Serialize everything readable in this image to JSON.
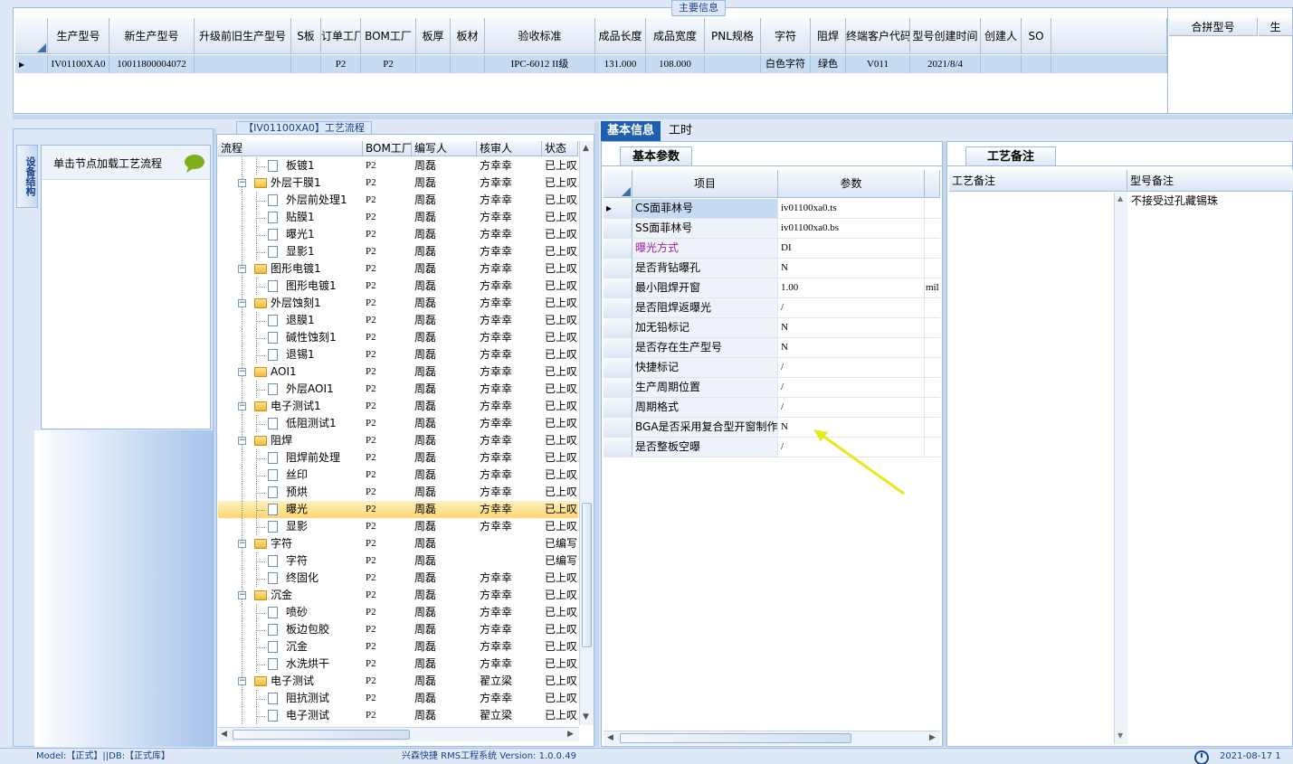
{
  "main_info": {
    "title": "主要信息",
    "columns": [
      "生产型号",
      "新生产型号",
      "升级前旧生产型号",
      "S板",
      "订单工厂",
      "BOM工厂",
      "板厚",
      "板材",
      "验收标准",
      "成品长度",
      "成品宽度",
      "PNL规格",
      "字符",
      "阻焊",
      "终端客户代码",
      "型号创建时间",
      "创建人",
      "SO"
    ],
    "row": [
      "IV01100XA0",
      "10011800004072",
      "",
      "",
      "P2",
      "P2",
      "",
      "",
      "IPC-6012 II级",
      "131.000",
      "108.000",
      "",
      "白色字符",
      "绿色",
      "V011",
      "2021/8/4",
      "",
      ""
    ],
    "side_columns": [
      "合拼型号",
      "生"
    ]
  },
  "left_panel": {
    "tab_label": "设备结构",
    "hint": "单击节点加载工艺流程"
  },
  "flow": {
    "title": "【IV01100XA0】工艺流程",
    "columns": [
      "流程",
      "BOM工厂",
      "编写人",
      "核审人",
      "状态"
    ],
    "rows": [
      {
        "level": 2,
        "type": "doc",
        "name": "板镀1",
        "bom": "P2",
        "writer": "周磊",
        "reviewer": "方幸幸",
        "status": "已上叹"
      },
      {
        "level": 1,
        "type": "folder",
        "name": "外层干膜1",
        "bom": "P2",
        "writer": "周磊",
        "reviewer": "方幸幸",
        "status": "已上叹"
      },
      {
        "level": 2,
        "type": "doc",
        "name": "外层前处理1",
        "bom": "P2",
        "writer": "周磊",
        "reviewer": "方幸幸",
        "status": "已上叹"
      },
      {
        "level": 2,
        "type": "doc",
        "name": "贴膜1",
        "bom": "P2",
        "writer": "周磊",
        "reviewer": "方幸幸",
        "status": "已上叹"
      },
      {
        "level": 2,
        "type": "doc",
        "name": "曝光1",
        "bom": "P2",
        "writer": "周磊",
        "reviewer": "方幸幸",
        "status": "已上叹"
      },
      {
        "level": 2,
        "type": "doc",
        "name": "显影1",
        "bom": "P2",
        "writer": "周磊",
        "reviewer": "方幸幸",
        "status": "已上叹"
      },
      {
        "level": 1,
        "type": "folder",
        "name": "图形电镀1",
        "bom": "P2",
        "writer": "周磊",
        "reviewer": "方幸幸",
        "status": "已上叹"
      },
      {
        "level": 2,
        "type": "doc",
        "name": "图形电镀1",
        "bom": "P2",
        "writer": "周磊",
        "reviewer": "方幸幸",
        "status": "已上叹"
      },
      {
        "level": 1,
        "type": "folder",
        "name": "外层蚀刻1",
        "bom": "P2",
        "writer": "周磊",
        "reviewer": "方幸幸",
        "status": "已上叹"
      },
      {
        "level": 2,
        "type": "doc",
        "name": "退膜1",
        "bom": "P2",
        "writer": "周磊",
        "reviewer": "方幸幸",
        "status": "已上叹"
      },
      {
        "level": 2,
        "type": "doc",
        "name": "碱性蚀刻1",
        "bom": "P2",
        "writer": "周磊",
        "reviewer": "方幸幸",
        "status": "已上叹"
      },
      {
        "level": 2,
        "type": "doc",
        "name": "退锡1",
        "bom": "P2",
        "writer": "周磊",
        "reviewer": "方幸幸",
        "status": "已上叹"
      },
      {
        "level": 1,
        "type": "folder",
        "name": "AOI1",
        "bom": "P2",
        "writer": "周磊",
        "reviewer": "方幸幸",
        "status": "已上叹"
      },
      {
        "level": 2,
        "type": "doc",
        "name": "外层AOI1",
        "bom": "P2",
        "writer": "周磊",
        "reviewer": "方幸幸",
        "status": "已上叹"
      },
      {
        "level": 1,
        "type": "folder",
        "name": "电子测试1",
        "bom": "P2",
        "writer": "周磊",
        "reviewer": "方幸幸",
        "status": "已上叹"
      },
      {
        "level": 2,
        "type": "doc",
        "name": "低阻测试1",
        "bom": "P2",
        "writer": "周磊",
        "reviewer": "方幸幸",
        "status": "已上叹"
      },
      {
        "level": 1,
        "type": "folder",
        "name": "阻焊",
        "bom": "P2",
        "writer": "周磊",
        "reviewer": "方幸幸",
        "status": "已上叹"
      },
      {
        "level": 2,
        "type": "doc",
        "name": "阻焊前处理",
        "bom": "P2",
        "writer": "周磊",
        "reviewer": "方幸幸",
        "status": "已上叹"
      },
      {
        "level": 2,
        "type": "doc",
        "name": "丝印",
        "bom": "P2",
        "writer": "周磊",
        "reviewer": "方幸幸",
        "status": "已上叹"
      },
      {
        "level": 2,
        "type": "doc",
        "name": "预烘",
        "bom": "P2",
        "writer": "周磊",
        "reviewer": "方幸幸",
        "status": "已上叹"
      },
      {
        "level": 2,
        "type": "doc",
        "name": "曝光",
        "bom": "P2",
        "writer": "周磊",
        "reviewer": "方幸幸",
        "status": "已上叹",
        "selected": true
      },
      {
        "level": 2,
        "type": "doc",
        "name": "显影",
        "bom": "P2",
        "writer": "周磊",
        "reviewer": "方幸幸",
        "status": "已上叹"
      },
      {
        "level": 1,
        "type": "folder",
        "name": "字符",
        "bom": "P2",
        "writer": "周磊",
        "reviewer": "",
        "status": "已编写"
      },
      {
        "level": 2,
        "type": "doc",
        "name": "字符",
        "bom": "P2",
        "writer": "周磊",
        "reviewer": "",
        "status": "已编写"
      },
      {
        "level": 2,
        "type": "doc",
        "name": "终固化",
        "bom": "P2",
        "writer": "周磊",
        "reviewer": "方幸幸",
        "status": "已上叹"
      },
      {
        "level": 1,
        "type": "folder",
        "name": "沉金",
        "bom": "P2",
        "writer": "周磊",
        "reviewer": "方幸幸",
        "status": "已上叹"
      },
      {
        "level": 2,
        "type": "doc",
        "name": "喷砂",
        "bom": "P2",
        "writer": "周磊",
        "reviewer": "方幸幸",
        "status": "已上叹"
      },
      {
        "level": 2,
        "type": "doc",
        "name": "板边包胶",
        "bom": "P2",
        "writer": "周磊",
        "reviewer": "方幸幸",
        "status": "已上叹"
      },
      {
        "level": 2,
        "type": "doc",
        "name": "沉金",
        "bom": "P2",
        "writer": "周磊",
        "reviewer": "方幸幸",
        "status": "已上叹"
      },
      {
        "level": 2,
        "type": "doc",
        "name": "水洗烘干",
        "bom": "P2",
        "writer": "周磊",
        "reviewer": "方幸幸",
        "status": "已上叹"
      },
      {
        "level": 1,
        "type": "folder",
        "name": "电子测试",
        "bom": "P2",
        "writer": "周磊",
        "reviewer": "翟立梁",
        "status": "已上叹"
      },
      {
        "level": 2,
        "type": "doc",
        "name": "阻抗测试",
        "bom": "P2",
        "writer": "周磊",
        "reviewer": "方幸幸",
        "status": "已上叹"
      },
      {
        "level": 2,
        "type": "doc",
        "name": "电子测试",
        "bom": "P2",
        "writer": "周磊",
        "reviewer": "翟立梁",
        "status": "已上叹"
      }
    ]
  },
  "tabs": [
    "基本信息",
    "工时"
  ],
  "params": {
    "subtab": "基本参数",
    "columns": [
      "项目",
      "参数"
    ],
    "rows": [
      {
        "item": "CS面菲林号",
        "value": "iv01100xa0.ts",
        "unit": "",
        "highlight": "selected"
      },
      {
        "item": "SS面菲林号",
        "value": "iv01100xa0.bs",
        "unit": ""
      },
      {
        "item": "曝光方式",
        "value": "DI",
        "unit": "",
        "highlight": "purple"
      },
      {
        "item": "是否背钻曝孔",
        "value": "N",
        "unit": ""
      },
      {
        "item": "最小阻焊开窗",
        "value": "1.00",
        "unit": "mil"
      },
      {
        "item": "是否阻焊返曝光",
        "value": "/",
        "unit": ""
      },
      {
        "item": "加无铅标记",
        "value": "N",
        "unit": ""
      },
      {
        "item": "是否存在生产型号",
        "value": "N",
        "unit": ""
      },
      {
        "item": "快捷标记",
        "value": "/",
        "unit": ""
      },
      {
        "item": "生产周期位置",
        "value": "/",
        "unit": ""
      },
      {
        "item": "周期格式",
        "value": "/",
        "unit": ""
      },
      {
        "item": "BGA是否采用复合型开窗制作",
        "value": "N",
        "unit": ""
      },
      {
        "item": "是否整板空曝",
        "value": "/",
        "unit": ""
      }
    ]
  },
  "remarks": {
    "subtab": "工艺备注",
    "columns": [
      "工艺备注",
      "型号备注"
    ],
    "process_remark": "",
    "model_remark": "不接受过孔藏锡珠"
  },
  "status_bar": {
    "model": "Model:【正式】||DB:【正式库】",
    "app": "兴森快捷 RMS工程系统 Version: 1.0.0.49",
    "datetime": "2021-08-17 1"
  },
  "colors": {
    "accent": "#99bbe8",
    "selected_row": "#c6dcf3",
    "tree_selected": "#ffd76e",
    "purple_text": "#a020a0",
    "annotation_arrow": "#f0f020"
  }
}
